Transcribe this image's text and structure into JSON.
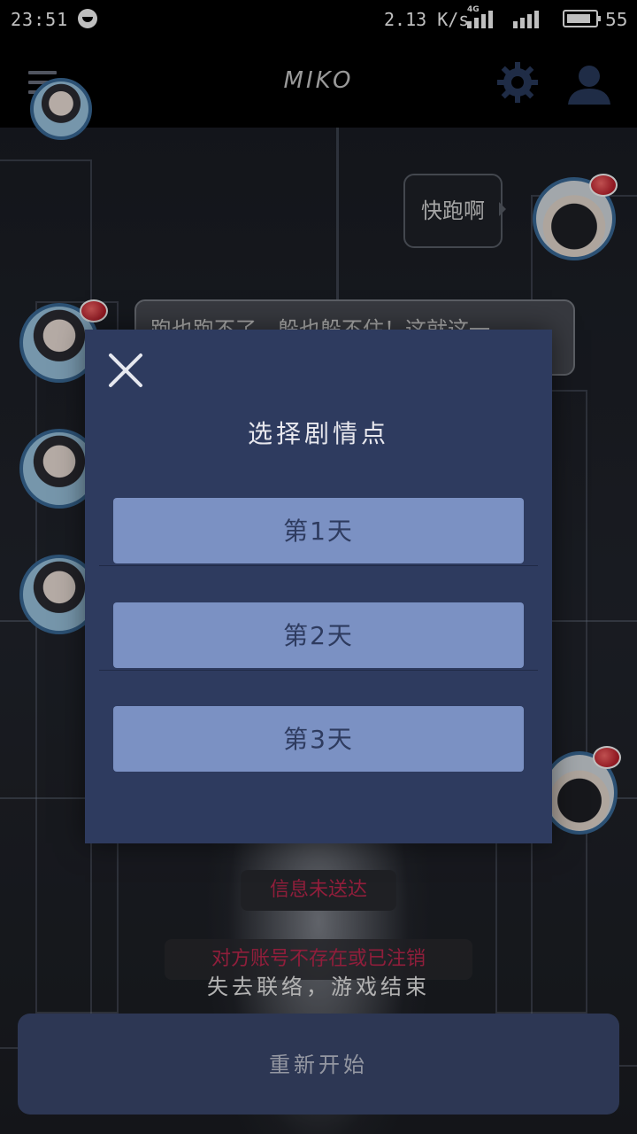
{
  "status_bar": {
    "time": "23:51",
    "net_speed": "2.13 K/s",
    "network_type": "4G",
    "battery_level": "55"
  },
  "app_bar": {
    "title": "MIKO",
    "menu_icon": "menu-icon",
    "settings_icon": "gear-icon",
    "profile_icon": "user-icon"
  },
  "chat": {
    "messages": [
      {
        "side": "right",
        "text": "快跑啊"
      },
      {
        "side": "left",
        "text": "跑也跑不了，躲也躲不住！这就这一"
      }
    ],
    "status_undelivered": "信息未送达",
    "status_account": "对方账号不存在或已注销",
    "game_over": "失去联络，游戏结束",
    "restart_label": "重新开始"
  },
  "modal": {
    "title": "选择剧情点",
    "options": [
      "第1天",
      "第2天",
      "第3天"
    ]
  },
  "colors": {
    "modal_bg": "#2e3b5f",
    "option_bg": "#7b91c3",
    "restart_bg": "#3c4a70",
    "alert_text": "#c0284f"
  }
}
